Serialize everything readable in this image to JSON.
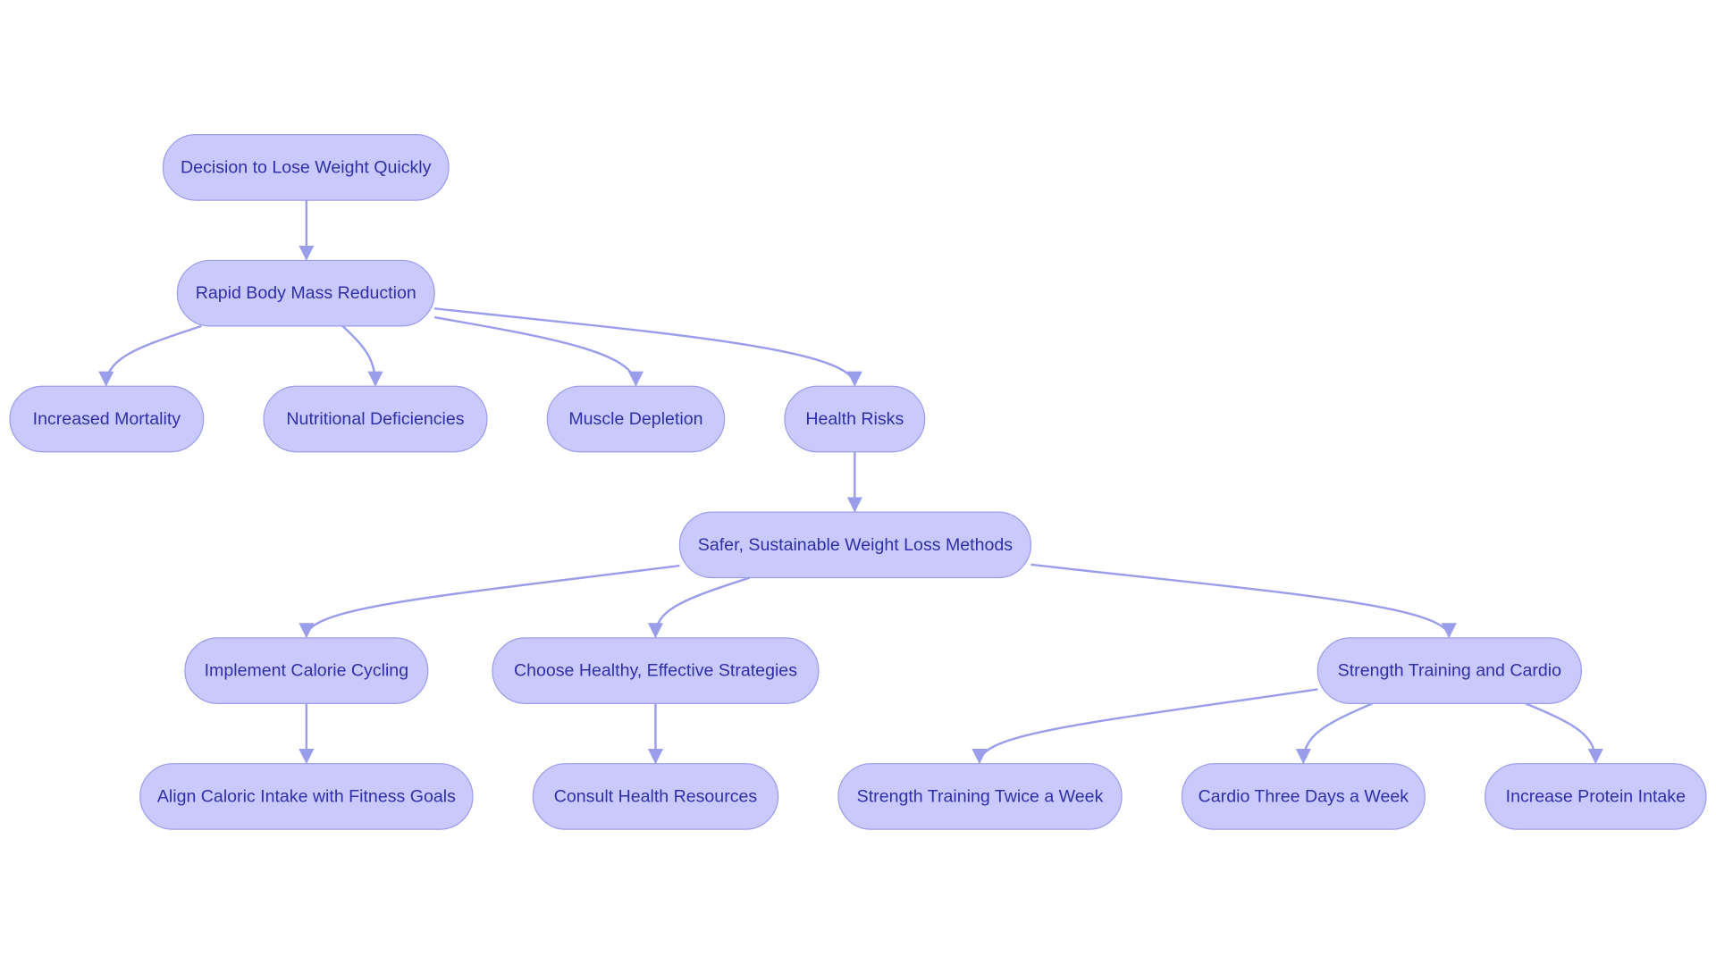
{
  "colors": {
    "node_fill": "#c9c9fc",
    "node_stroke": "#9c9ced",
    "text": "#2f2fa8",
    "edge": "#9a9eea",
    "background": "#ffffff"
  },
  "nodes": [
    {
      "id": "decision",
      "label": "Decision to Lose Weight Quickly"
    },
    {
      "id": "rapid",
      "label": "Rapid Body Mass Reduction"
    },
    {
      "id": "mortality",
      "label": "Increased Mortality"
    },
    {
      "id": "nutritional",
      "label": "Nutritional Deficiencies"
    },
    {
      "id": "muscle",
      "label": "Muscle Depletion"
    },
    {
      "id": "health",
      "label": "Health Risks"
    },
    {
      "id": "safer",
      "label": "Safer, Sustainable Weight Loss Methods"
    },
    {
      "id": "cycling",
      "label": "Implement Calorie Cycling"
    },
    {
      "id": "choose",
      "label": "Choose Healthy, Effective Strategies"
    },
    {
      "id": "strength_cardio",
      "label": "Strength Training and Cardio"
    },
    {
      "id": "align",
      "label": "Align Caloric Intake with Fitness Goals"
    },
    {
      "id": "consult",
      "label": "Consult Health Resources"
    },
    {
      "id": "strength_twice",
      "label": "Strength Training Twice a Week"
    },
    {
      "id": "cardio_three",
      "label": "Cardio Three Days a Week"
    },
    {
      "id": "protein",
      "label": "Increase Protein Intake"
    }
  ],
  "edges": [
    [
      "decision",
      "rapid"
    ],
    [
      "rapid",
      "mortality"
    ],
    [
      "rapid",
      "nutritional"
    ],
    [
      "rapid",
      "muscle"
    ],
    [
      "rapid",
      "health"
    ],
    [
      "health",
      "safer"
    ],
    [
      "safer",
      "cycling"
    ],
    [
      "safer",
      "choose"
    ],
    [
      "safer",
      "strength_cardio"
    ],
    [
      "cycling",
      "align"
    ],
    [
      "choose",
      "consult"
    ],
    [
      "strength_cardio",
      "strength_twice"
    ],
    [
      "strength_cardio",
      "cardio_three"
    ],
    [
      "strength_cardio",
      "protein"
    ]
  ]
}
